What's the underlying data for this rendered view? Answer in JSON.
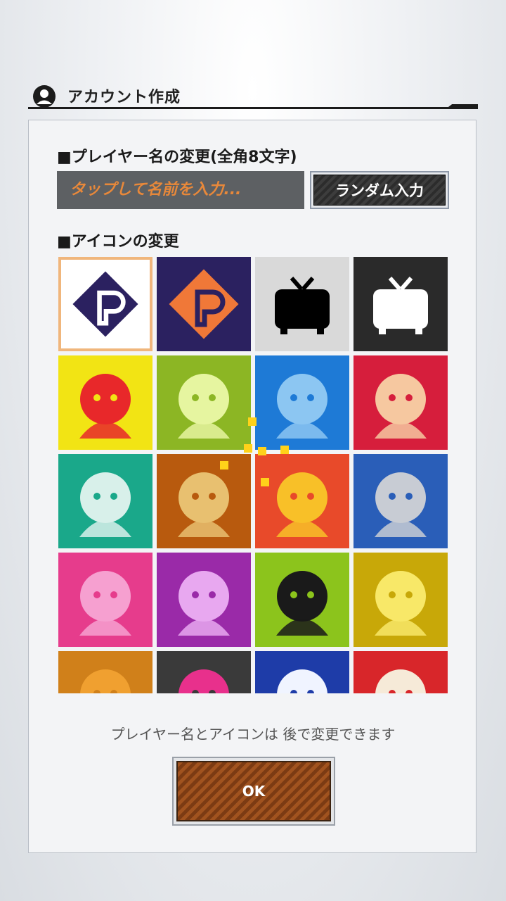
{
  "header": {
    "title": "アカウント作成",
    "icon": "user-circle-icon"
  },
  "player_name": {
    "section_label": "■プレイヤー名の変更(全角8文字)",
    "input_placeholder": "タップして名前を入力...",
    "random_button_label": "ランダム入力"
  },
  "icon_section": {
    "section_label": "■アイコンの変更",
    "selected_index": 0,
    "icons": [
      {
        "name": "logo-navy-on-white-icon",
        "bg": "#ffffff",
        "fg": "#2b2160"
      },
      {
        "name": "logo-orange-on-navy-icon",
        "bg": "#2b2160",
        "fg": "#f07838"
      },
      {
        "name": "tv-black-on-gray-icon",
        "bg": "#d9d9d9",
        "fg": "#000000"
      },
      {
        "name": "tv-white-on-black-icon",
        "bg": "#2a2a2a",
        "fg": "#ffffff"
      },
      {
        "name": "hero-star-icon",
        "bg": "#f2e414",
        "fg": "#e8282a"
      },
      {
        "name": "lightbulb-robot-icon",
        "bg": "#8cb624",
        "fg": "#e6f5a0"
      },
      {
        "name": "wave-splash-icon",
        "bg": "#1e7ad6",
        "fg": "#8cc6f2"
      },
      {
        "name": "fist-volcano-icon",
        "bg": "#d61e3c",
        "fg": "#f6c8a0"
      },
      {
        "name": "tech-cubes-icon",
        "bg": "#1aa88a",
        "fg": "#d8f0ea"
      },
      {
        "name": "gun-swirl-icon",
        "bg": "#b85a0e",
        "fg": "#e8c070"
      },
      {
        "name": "headphone-character-icon",
        "bg": "#e84a2a",
        "fg": "#f8c028"
      },
      {
        "name": "robot-visor-icon",
        "bg": "#2a5eb8",
        "fg": "#c8ccd4"
      },
      {
        "name": "pink-hair-character-icon",
        "bg": "#e63c8c",
        "fg": "#f6a0d0"
      },
      {
        "name": "purple-glasses-character-icon",
        "bg": "#9a2aa8",
        "fg": "#e8a8f0"
      },
      {
        "name": "hand-eye-character-icon",
        "bg": "#8cc41c",
        "fg": "#1a1a1a"
      },
      {
        "name": "blonde-laurel-character-icon",
        "bg": "#c8a808",
        "fg": "#f8e868"
      },
      {
        "name": "orange-cat-character-icon",
        "bg": "#d0801a",
        "fg": "#f0a030"
      },
      {
        "name": "pink-hair-goggles-character-icon",
        "bg": "#3a3a3a",
        "fg": "#e8308c"
      },
      {
        "name": "white-hair-character-icon",
        "bg": "#1e3ca8",
        "fg": "#f0f4ff"
      },
      {
        "name": "white-curl-character-icon",
        "bg": "#d8262a",
        "fg": "#f6ead8"
      }
    ]
  },
  "footer": {
    "note": "プレイヤー名とアイコンは 後で変更できます",
    "ok_button_label": "OK"
  },
  "colors": {
    "accent_orange": "#e8883a",
    "selected_border": "#f0b67c"
  }
}
